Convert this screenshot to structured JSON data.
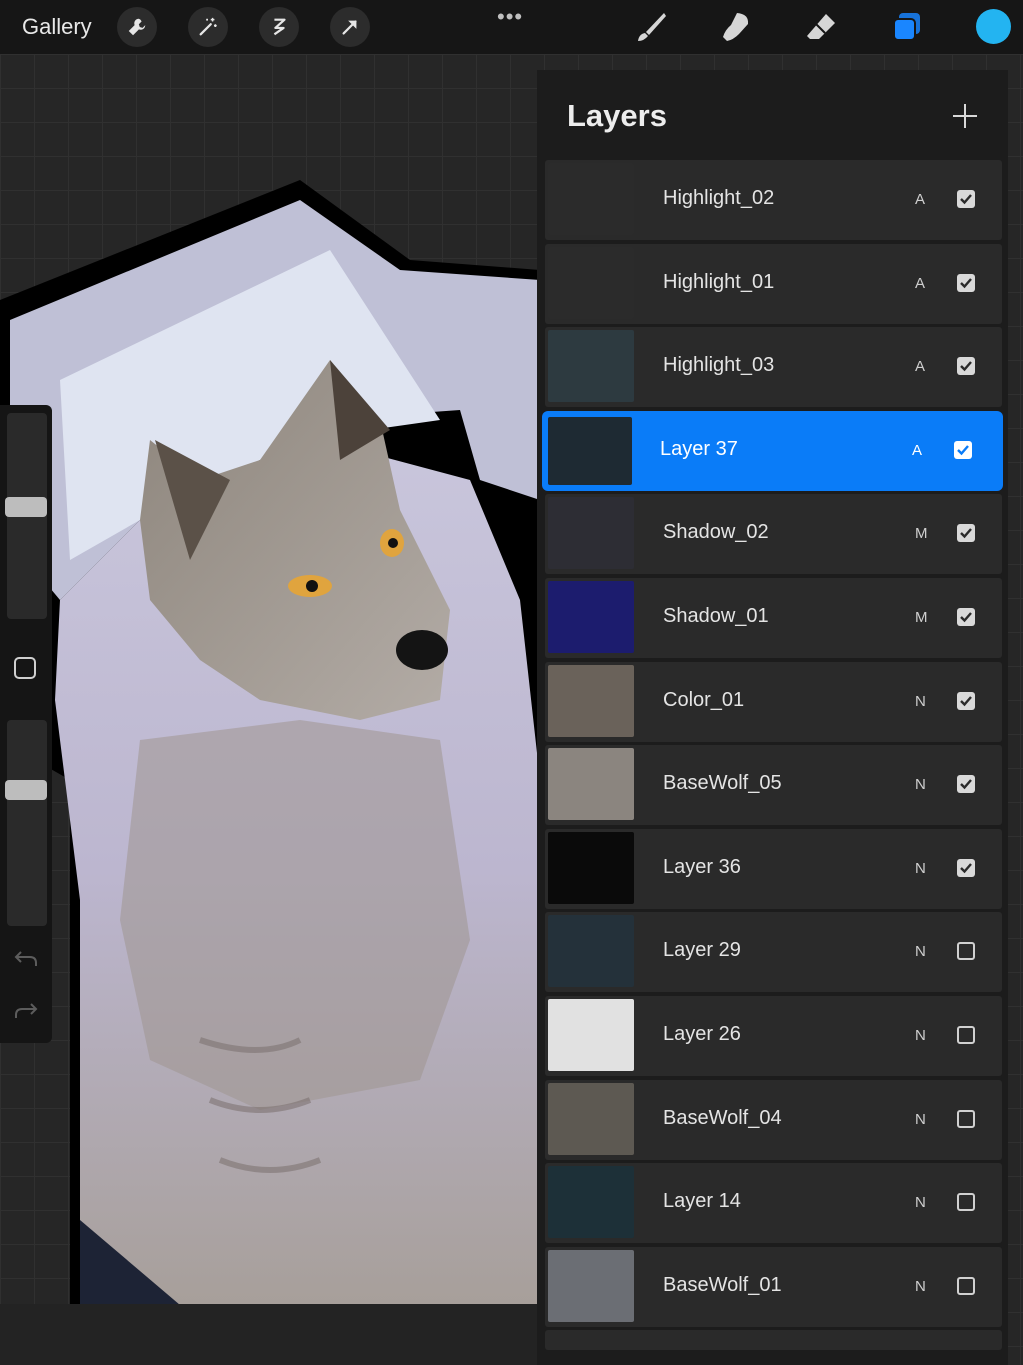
{
  "topbar": {
    "gallery_label": "Gallery",
    "more_label": "•••",
    "current_color": "#23b4f1"
  },
  "layers_panel": {
    "title": "Layers",
    "add_label": "+",
    "layers": [
      {
        "name": "Highlight_02",
        "blend": "A",
        "visible": true,
        "selected": false
      },
      {
        "name": "Highlight_01",
        "blend": "A",
        "visible": true,
        "selected": false
      },
      {
        "name": "Highlight_03",
        "blend": "A",
        "visible": true,
        "selected": false
      },
      {
        "name": "Layer 37",
        "blend": "A",
        "visible": true,
        "selected": true
      },
      {
        "name": "Shadow_02",
        "blend": "M",
        "visible": true,
        "selected": false
      },
      {
        "name": "Shadow_01",
        "blend": "M",
        "visible": true,
        "selected": false
      },
      {
        "name": "Color_01",
        "blend": "N",
        "visible": true,
        "selected": false
      },
      {
        "name": "BaseWolf_05",
        "blend": "N",
        "visible": true,
        "selected": false
      },
      {
        "name": "Layer 36",
        "blend": "N",
        "visible": true,
        "selected": false
      },
      {
        "name": "Layer 29",
        "blend": "N",
        "visible": false,
        "selected": false
      },
      {
        "name": "Layer 26",
        "blend": "N",
        "visible": false,
        "selected": false
      },
      {
        "name": "BaseWolf_04",
        "blend": "N",
        "visible": false,
        "selected": false
      },
      {
        "name": "Layer 14",
        "blend": "N",
        "visible": false,
        "selected": false
      },
      {
        "name": "BaseWolf_01",
        "blend": "N",
        "visible": false,
        "selected": false
      }
    ]
  },
  "sidebar": {
    "brush_size_level": 0.55,
    "opacity_level": 0.68
  }
}
